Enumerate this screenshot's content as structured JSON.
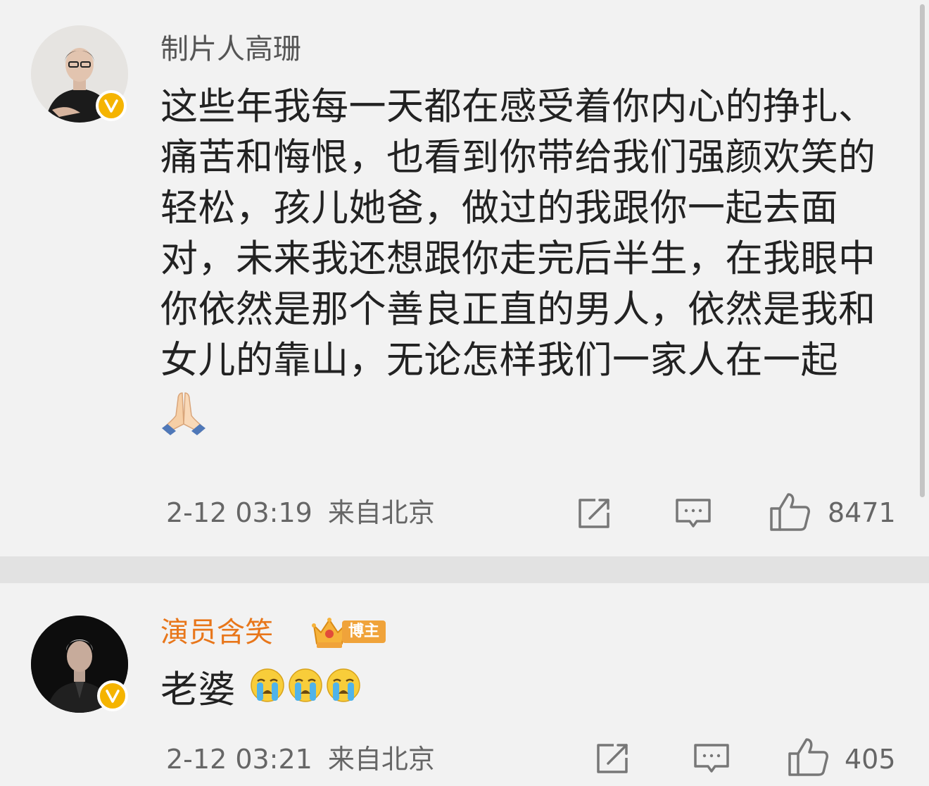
{
  "posts": [
    {
      "username": "制片人高珊",
      "verified": true,
      "text_lines": [
        "这些年我每一天都在感受着你内心的挣扎、",
        "痛苦和悔恨，也看到你带给我们强颜欢笑的",
        "轻松，孩儿她爸，做过的我跟你一起去面",
        "对，未来我还想跟你走完后半生，在我眼中",
        "你依然是那个善良正直的男人，依然是我和",
        "女儿的靠山，无论怎样我们一家人在一起"
      ],
      "emoji": "folded-hands-emoji",
      "time": "2-12 03:19",
      "location": "来自北京",
      "likes": "8471"
    },
    {
      "username": "演员含笑",
      "verified": true,
      "badge_label": "博主",
      "text": "老婆",
      "emoji": "loudly-crying-face-emoji",
      "time": "2-12 03:21",
      "location": "来自北京",
      "likes": "405"
    }
  ],
  "colors": {
    "background": "#f2f2f2",
    "separator": "#e2e2e2",
    "username_default": "#555555",
    "username_vip": "#e8761a",
    "verified_badge": "#f5b400",
    "text": "#222222",
    "meta": "#666666",
    "icon": "#777777"
  }
}
